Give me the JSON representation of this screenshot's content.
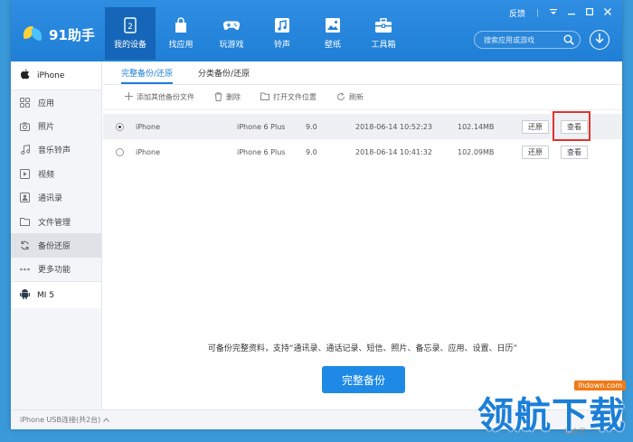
{
  "app": {
    "logo_text": "91助手"
  },
  "nav": [
    {
      "label": "我的设备",
      "icon": "phone-device-icon",
      "active": true
    },
    {
      "label": "找应用",
      "icon": "shopping-bag-icon"
    },
    {
      "label": "玩游戏",
      "icon": "gamepad-icon"
    },
    {
      "label": "铃声",
      "icon": "music-note-icon"
    },
    {
      "label": "壁纸",
      "icon": "picture-icon"
    },
    {
      "label": "工具箱",
      "icon": "toolbox-icon"
    }
  ],
  "window": {
    "feedback": "反馈"
  },
  "search": {
    "placeholder": "搜索应用或游戏"
  },
  "sidebar": {
    "device": "iPhone",
    "items": [
      {
        "label": "应用",
        "icon": "apps-grid-icon"
      },
      {
        "label": "照片",
        "icon": "camera-icon"
      },
      {
        "label": "音乐铃声",
        "icon": "music-icon"
      },
      {
        "label": "视频",
        "icon": "video-icon"
      },
      {
        "label": "通讯录",
        "icon": "contacts-icon"
      },
      {
        "label": "文件管理",
        "icon": "folder-icon"
      },
      {
        "label": "备份还原",
        "icon": "refresh-icon",
        "active": true
      },
      {
        "label": "更多功能",
        "icon": "more-dots-icon"
      }
    ],
    "device2": "MI 5"
  },
  "tabs": [
    {
      "label": "完整备份/还原",
      "active": true
    },
    {
      "label": "分类备份/还原"
    }
  ],
  "toolbar": {
    "add": "添加其他备份文件",
    "delete": "删除",
    "open": "打开文件位置",
    "refresh": "刷新"
  },
  "rows": [
    {
      "name": "iPhone",
      "model": "iPhone 6 Plus",
      "version": "9.0",
      "date": "2018-06-14 10:52:23",
      "size": "102.14MB",
      "restore": "还原",
      "view": "查看",
      "selected": true
    },
    {
      "name": "iPhone",
      "model": "iPhone 6 Plus",
      "version": "9.0",
      "date": "2018-06-14 10:41:32",
      "size": "102.09MB",
      "restore": "还原",
      "view": "查看",
      "selected": false
    }
  ],
  "bottom_note": "可备份完整资料，支持“通讯录、通话记录、短信、照片、备忘录、应用、设置、日历”",
  "backup_button": "完整备份",
  "status": {
    "text": "iPhone  USB连接(共2台)",
    "version": "版本号"
  },
  "watermark": {
    "text": "领航下载",
    "url": "lhdown.com"
  },
  "colors": {
    "accent": "#1f7fd6",
    "highlight": "#e5322d"
  }
}
